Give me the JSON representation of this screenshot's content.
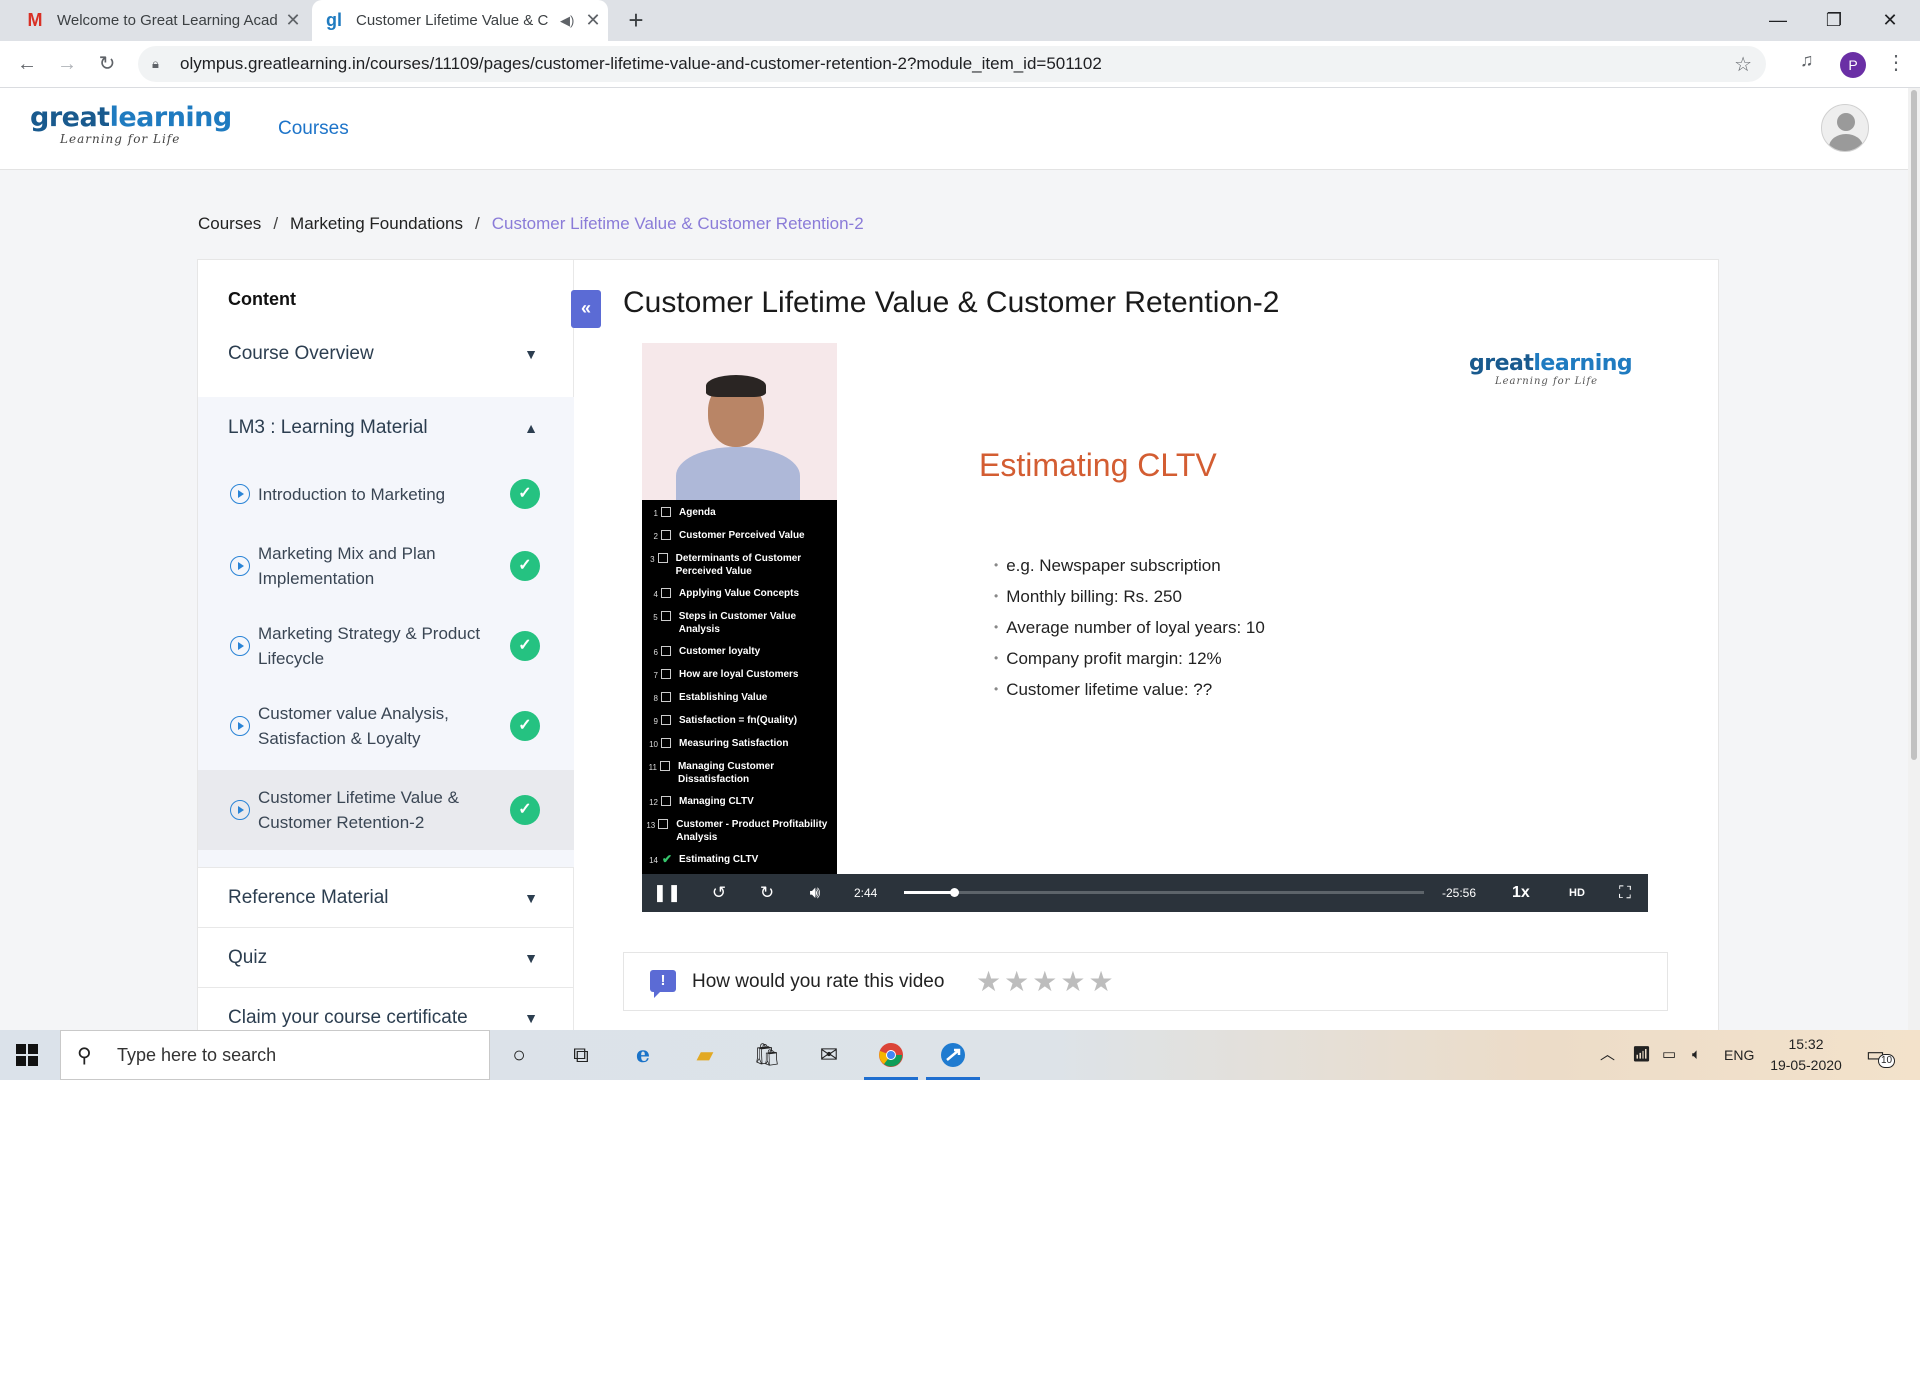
{
  "browser": {
    "tabs": [
      {
        "title": "Welcome to Great Learning Acad",
        "favicon": "gmail-icon"
      },
      {
        "title": "Customer Lifetime Value & C",
        "favicon": "greatlearning-icon",
        "active": true,
        "audio": true
      }
    ],
    "url": "olympus.greatlearning.in/courses/11109/pages/customer-lifetime-value-and-customer-retention-2?module_item_id=501102",
    "profile_initial": "P"
  },
  "header": {
    "logo": {
      "brand_a": "great",
      "brand_b": "learning",
      "tagline": "Learning for Life"
    },
    "nav_courses": "Courses"
  },
  "breadcrumb": {
    "items": [
      "Courses",
      "Marketing Foundations"
    ],
    "current": "Customer Lifetime Value & Customer Retention-2",
    "separator": "/"
  },
  "sidebar": {
    "heading": "Content",
    "sections": [
      {
        "label": "Course Overview",
        "expanded": false
      },
      {
        "label": "LM3 : Learning Material",
        "expanded": true
      },
      {
        "label": "Reference Material",
        "expanded": false
      },
      {
        "label": "Quiz",
        "expanded": false
      },
      {
        "label": "Claim your course certificate",
        "expanded": false
      }
    ],
    "lessons": [
      {
        "label": "Introduction to Marketing",
        "completed": true
      },
      {
        "label": "Marketing Mix and Plan Implementation",
        "completed": true
      },
      {
        "label": "Marketing Strategy & Product Lifecycle",
        "completed": true
      },
      {
        "label": "Customer value Analysis, Satisfaction & Loyalty",
        "completed": true
      },
      {
        "label": "Customer Lifetime Value & Customer Retention-2",
        "completed": true,
        "active": true
      }
    ]
  },
  "main": {
    "title": "Customer Lifetime Value & Customer Retention-2",
    "video": {
      "agenda": [
        {
          "n": "1",
          "text": "Agenda"
        },
        {
          "n": "2",
          "text": "Customer Perceived Value"
        },
        {
          "n": "3",
          "text": "Determinants of Customer Perceived Value"
        },
        {
          "n": "4",
          "text": "Applying Value Concepts"
        },
        {
          "n": "5",
          "text": "Steps in Customer Value Analysis"
        },
        {
          "n": "6",
          "text": "Customer loyalty"
        },
        {
          "n": "7",
          "text": "How are loyal Customers"
        },
        {
          "n": "8",
          "text": "Establishing Value"
        },
        {
          "n": "9",
          "text": "Satisfaction = fn(Quality)"
        },
        {
          "n": "10",
          "text": "Measuring Satisfaction"
        },
        {
          "n": "11",
          "text": "Managing Customer Dissatisfaction"
        },
        {
          "n": "12",
          "text": "Managing CLTV"
        },
        {
          "n": "13",
          "text": "Customer - Product Profitability Analysis"
        },
        {
          "n": "14",
          "text": "Estimating CLTV",
          "checked": true
        }
      ],
      "slide_logo": {
        "brand_a": "great",
        "brand_b": "learning",
        "tagline": "Learning for Life"
      },
      "slide_title": "Estimating CLTV",
      "slide_bullets": [
        "e.g. Newspaper subscription",
        "Monthly billing: Rs. 250",
        "Average number of loyal years: 10",
        "Company profit margin: 12%",
        "Customer lifetime value: ??"
      ],
      "time_current": "2:44",
      "time_remaining": "-25:56",
      "progress_fraction": 0.096,
      "speed": "1x"
    },
    "rating": {
      "prompt": "How would you rate this video",
      "stars": 5,
      "icon_glyph": "!"
    }
  },
  "taskbar": {
    "search_placeholder": "Type here to search",
    "lang": "ENG",
    "time": "15:32",
    "date": "19-05-2020",
    "notifications": "10"
  },
  "colors": {
    "accent": "#5b6bd5",
    "link": "#1d74c9",
    "complete": "#25c281",
    "slide_title": "#d35d32",
    "breadcrumb_current": "#8a7bd8"
  }
}
